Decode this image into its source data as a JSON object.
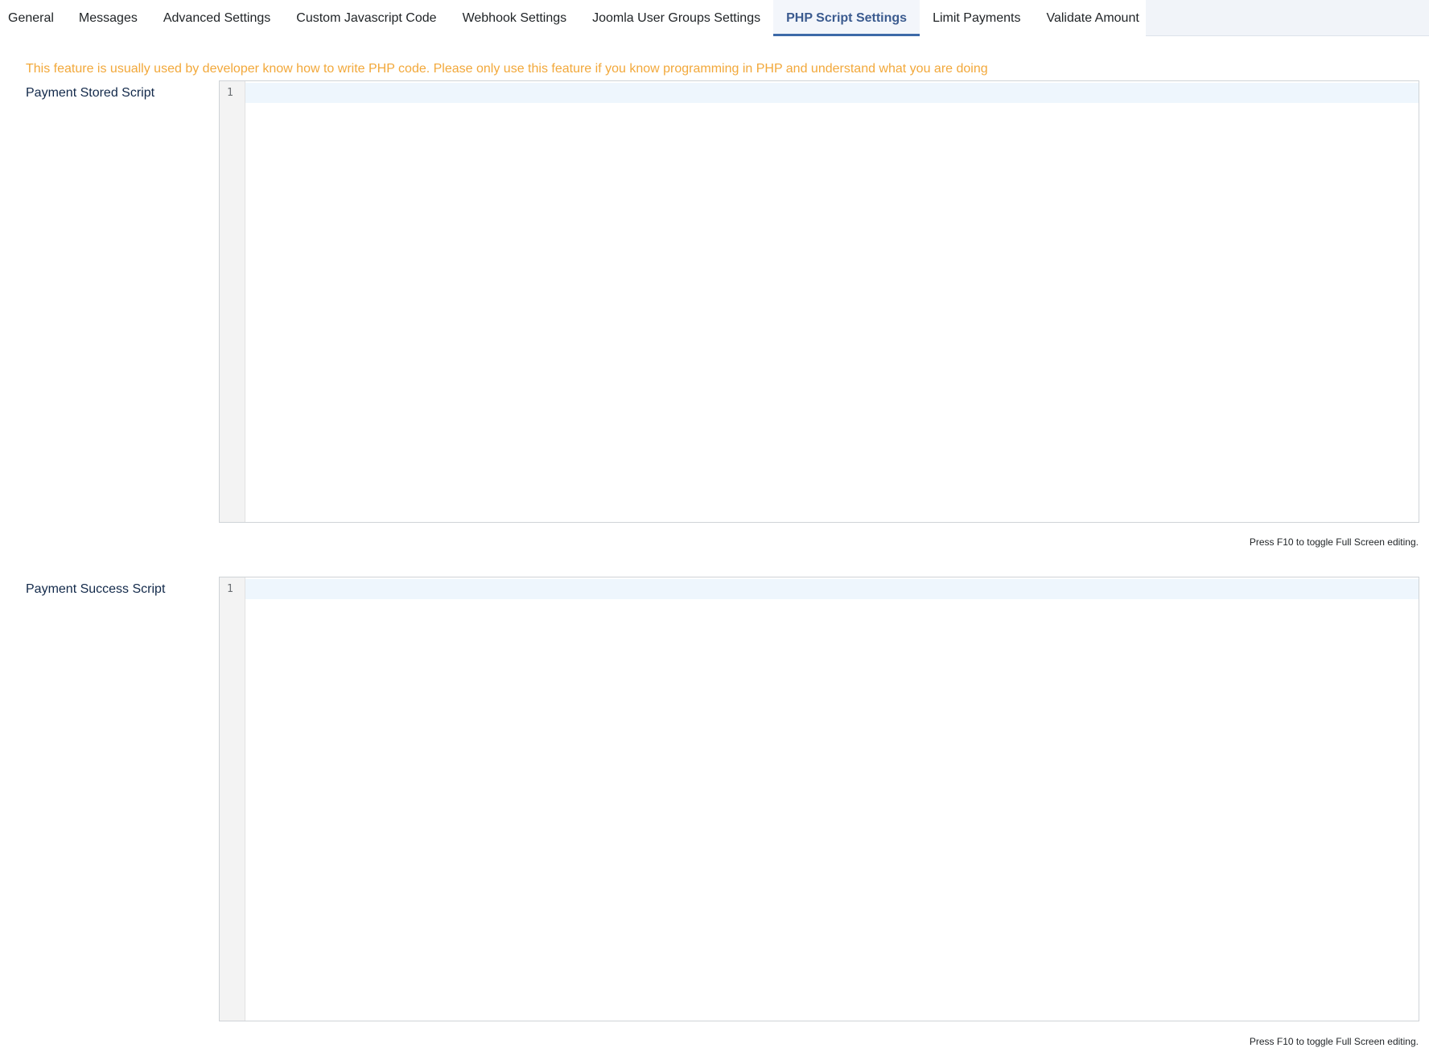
{
  "tabs": [
    {
      "label": "General"
    },
    {
      "label": "Messages"
    },
    {
      "label": "Advanced Settings"
    },
    {
      "label": "Custom Javascript Code"
    },
    {
      "label": "Webhook Settings"
    },
    {
      "label": "Joomla User Groups Settings"
    },
    {
      "label": "PHP Script Settings"
    },
    {
      "label": "Limit Payments"
    },
    {
      "label": "Validate Amount"
    }
  ],
  "active_tab": "PHP Script Settings",
  "warning": "This feature is usually used by developer know how to write PHP code. Please only use this feature if you know programming in PHP and understand what you are doing",
  "fields": {
    "stored": {
      "label": "Payment Stored Script",
      "line_number": "1",
      "hint": "Press F10 to toggle Full Screen editing."
    },
    "success": {
      "label": "Payment Success Script",
      "line_number": "1",
      "hint": "Press F10 to toggle Full Screen editing."
    }
  },
  "colors": {
    "warning": "#f2a83a",
    "active_tab": "#3b5b8f",
    "label": "#12294a"
  }
}
